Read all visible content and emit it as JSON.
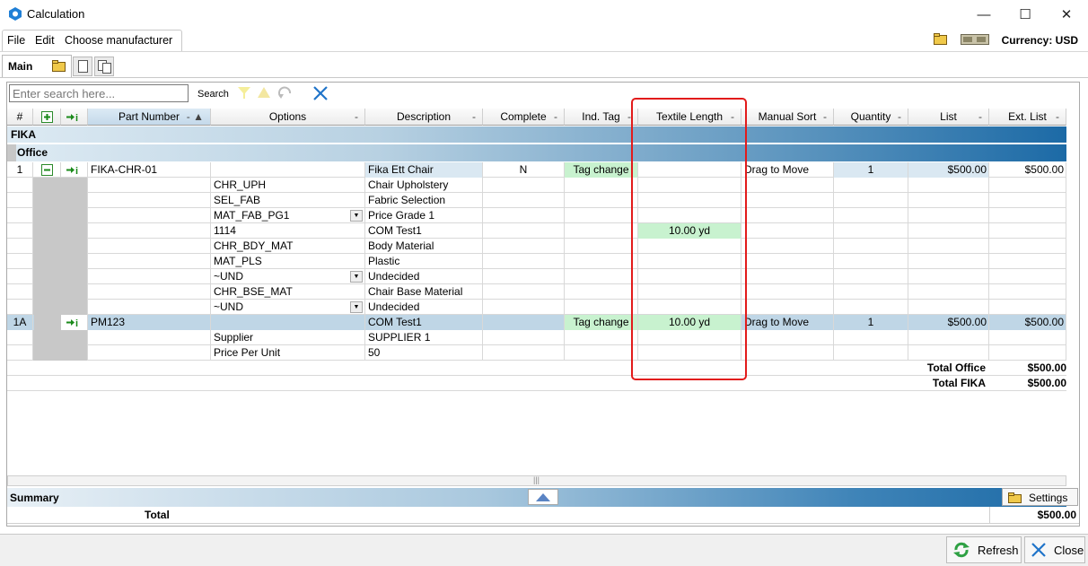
{
  "window": {
    "title": "Calculation"
  },
  "menu": {
    "items": [
      "File",
      "Edit",
      "Choose manufacturer"
    ]
  },
  "currency_label": "Currency: USD",
  "tabs": {
    "main_label": "Main"
  },
  "search": {
    "placeholder": "Enter search here...",
    "label": "Search"
  },
  "grid": {
    "columns": [
      "#",
      "Part Number",
      "Options",
      "Description",
      "Complete",
      "Ind. Tag",
      "Textile Length",
      "Manual Sort",
      "Quantity",
      "List",
      "Ext. List"
    ],
    "group1": "FIKA",
    "group2": "Office",
    "rows": [
      {
        "num": "1",
        "part": "FIKA-CHR-01",
        "opt": "",
        "desc": "Fika Ett Chair",
        "complete": "N",
        "tag": "Tag change",
        "textile": "",
        "sort": "Drag to Move",
        "qty": "1",
        "list": "$500.00",
        "ext": "$500.00"
      },
      {
        "num": "",
        "part": "",
        "opt": "CHR_UPH",
        "desc": "Chair Upholstery",
        "complete": "",
        "tag": "",
        "textile": "",
        "sort": "",
        "qty": "",
        "list": "",
        "ext": ""
      },
      {
        "num": "",
        "part": "",
        "opt": "SEL_FAB",
        "desc": "Fabric Selection",
        "complete": "",
        "tag": "",
        "textile": "",
        "sort": "",
        "qty": "",
        "list": "",
        "ext": ""
      },
      {
        "num": "",
        "part": "",
        "opt": "MAT_FAB_PG1",
        "desc": "Price Grade 1",
        "complete": "",
        "tag": "",
        "textile": "",
        "sort": "",
        "qty": "",
        "list": "",
        "ext": ""
      },
      {
        "num": "",
        "part": "",
        "opt": "1114",
        "desc": "COM Test1",
        "complete": "",
        "tag": "",
        "textile": "10.00 yd",
        "sort": "",
        "qty": "",
        "list": "",
        "ext": ""
      },
      {
        "num": "",
        "part": "",
        "opt": "CHR_BDY_MAT",
        "desc": "Body Material",
        "complete": "",
        "tag": "",
        "textile": "",
        "sort": "",
        "qty": "",
        "list": "",
        "ext": ""
      },
      {
        "num": "",
        "part": "",
        "opt": "MAT_PLS",
        "desc": "Plastic",
        "complete": "",
        "tag": "",
        "textile": "",
        "sort": "",
        "qty": "",
        "list": "",
        "ext": ""
      },
      {
        "num": "",
        "part": "",
        "opt": "~UND",
        "desc": "Undecided",
        "complete": "",
        "tag": "",
        "textile": "",
        "sort": "",
        "qty": "",
        "list": "",
        "ext": ""
      },
      {
        "num": "",
        "part": "",
        "opt": "CHR_BSE_MAT",
        "desc": "Chair Base Material",
        "complete": "",
        "tag": "",
        "textile": "",
        "sort": "",
        "qty": "",
        "list": "",
        "ext": ""
      },
      {
        "num": "",
        "part": "",
        "opt": "~UND",
        "desc": "Undecided",
        "complete": "",
        "tag": "",
        "textile": "",
        "sort": "",
        "qty": "",
        "list": "",
        "ext": ""
      },
      {
        "num": "1A",
        "part": "PM123",
        "opt": "",
        "desc": "COM Test1",
        "complete": "",
        "tag": "Tag change",
        "textile": "10.00 yd",
        "sort": "Drag to Move",
        "qty": "1",
        "list": "$500.00",
        "ext": "$500.00"
      },
      {
        "num": "",
        "part": "",
        "opt": "Supplier",
        "desc": "SUPPLIER 1",
        "complete": "",
        "tag": "",
        "textile": "",
        "sort": "",
        "qty": "",
        "list": "",
        "ext": ""
      },
      {
        "num": "",
        "part": "",
        "opt": "Price Per Unit",
        "desc": "50",
        "complete": "",
        "tag": "",
        "textile": "",
        "sort": "",
        "qty": "",
        "list": "",
        "ext": ""
      }
    ],
    "totals": [
      {
        "label": "Total Office",
        "value": "$500.00"
      },
      {
        "label": "Total FIKA",
        "value": "$500.00"
      }
    ]
  },
  "summary": {
    "label": "Summary",
    "settings_label": "Settings",
    "total_label": "Total",
    "total_value": "$500.00"
  },
  "buttons": {
    "refresh": "Refresh",
    "close": "Close"
  },
  "colors": {
    "highlight": "#e21b1b",
    "green_cell": "#c8f2cf",
    "header_blue": "#1c6aa6"
  }
}
